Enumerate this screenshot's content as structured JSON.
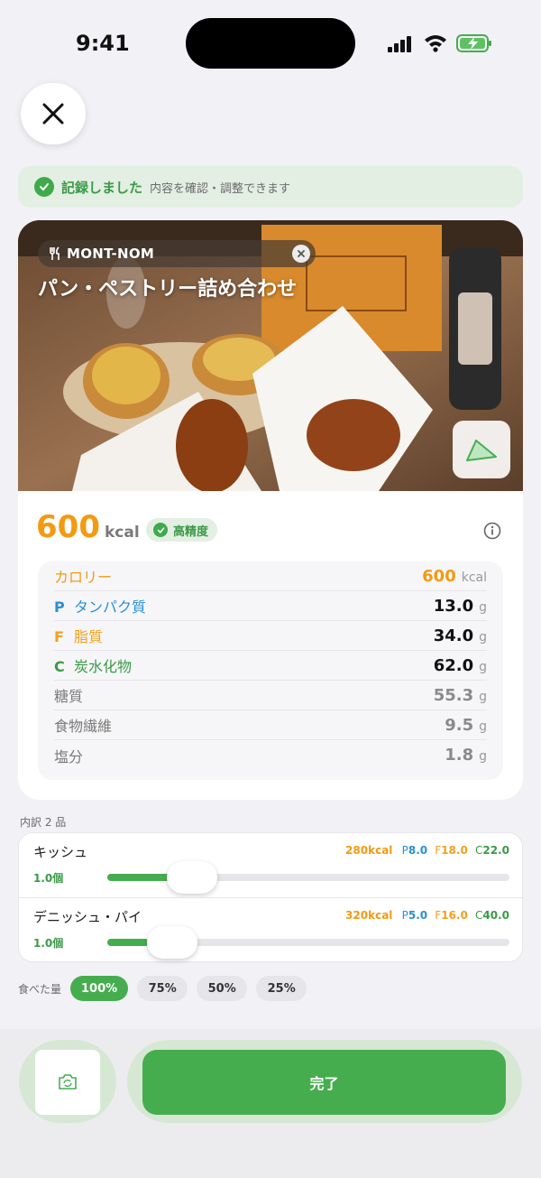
{
  "status_bar": {
    "time": "9:41"
  },
  "banner": {
    "title": "記録しました",
    "subtitle": "内容を確認・調整できます"
  },
  "photo": {
    "brand": "MONT-NOM",
    "meal_title": "パン・ペストリー詰め合わせ"
  },
  "summary": {
    "kcal": "600",
    "kcal_unit": "kcal",
    "accuracy_badge": "高精度"
  },
  "nutrition": [
    {
      "letter": "",
      "label": "カロリー",
      "value": "600",
      "unit": "kcal",
      "color": "#f29a12",
      "value_color": "#f29a12"
    },
    {
      "letter": "P",
      "label": "タンパク質",
      "value": "13.0",
      "unit": "g",
      "color": "#2a8fd6",
      "value_color": "#111111"
    },
    {
      "letter": "F",
      "label": "脂質",
      "value": "34.0",
      "unit": "g",
      "color": "#f2a01c",
      "value_color": "#111111"
    },
    {
      "letter": "C",
      "label": "炭水化物",
      "value": "62.0",
      "unit": "g",
      "color": "#3a9a47",
      "value_color": "#111111"
    },
    {
      "letter": "",
      "label": "糖質",
      "value": "55.3",
      "unit": "g",
      "color": "#7a7a7a",
      "value_color": "#8a8a8a"
    },
    {
      "letter": "",
      "label": "食物繊維",
      "value": "9.5",
      "unit": "g",
      "color": "#7a7a7a",
      "value_color": "#8a8a8a"
    },
    {
      "letter": "",
      "label": "塩分",
      "value": "1.8",
      "unit": "g",
      "color": "#7a7a7a",
      "value_color": "#8a8a8a"
    }
  ],
  "breakdown": {
    "label": "内訳 2 品",
    "items": [
      {
        "name": "キッシュ",
        "kcal": "280kcal",
        "p": "8.0",
        "f": "18.0",
        "c": "22.0",
        "qty": "1.0個",
        "slider_fraction": 0.2
      },
      {
        "name": "デニッシュ・パイ",
        "kcal": "320kcal",
        "p": "5.0",
        "f": "16.0",
        "c": "40.0",
        "qty": "1.0個",
        "slider_fraction": 0.1
      }
    ],
    "macro_letters": {
      "p": "P",
      "f": "F",
      "c": "C"
    }
  },
  "eaten": {
    "label": "食べた量",
    "options": [
      "100%",
      "75%",
      "50%",
      "25%"
    ],
    "selected": "100%"
  },
  "actions": {
    "done_label": "完了"
  },
  "colors": {
    "accent": "#46ad4f",
    "calorie": "#f29a12",
    "protein": "#2a8fd6",
    "fat": "#f2a01c",
    "carb": "#3a9a47"
  },
  "icons": [
    "close-icon",
    "check-circle-icon",
    "fork-knife-icon",
    "clear-icon",
    "map-icon",
    "info-icon",
    "camera-rotate-icon"
  ]
}
